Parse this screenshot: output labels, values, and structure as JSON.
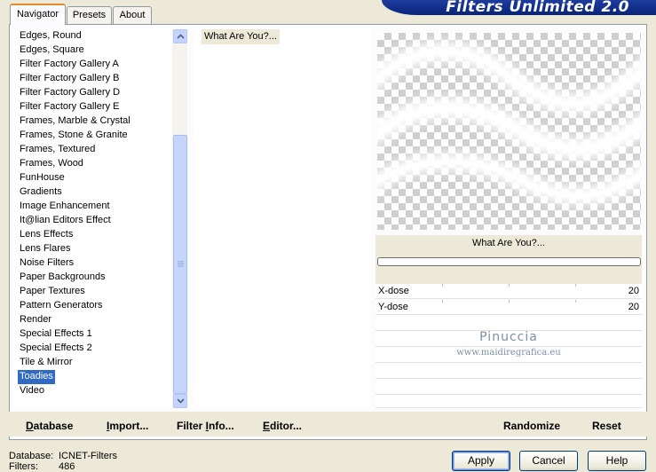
{
  "banner": {
    "title": "Filters Unlimited 2.0"
  },
  "tabs": [
    {
      "label": "Navigator",
      "active": true
    },
    {
      "label": "Presets",
      "active": false
    },
    {
      "label": "About",
      "active": false
    }
  ],
  "categories": [
    "Edges, Round",
    "Edges, Square",
    "Filter Factory Gallery A",
    "Filter Factory Gallery B",
    "Filter Factory Gallery D",
    "Filter Factory Gallery E",
    "Frames, Marble & Crystal",
    "Frames, Stone & Granite",
    "Frames, Textured",
    "Frames, Wood",
    "FunHouse",
    "Gradients",
    "Image Enhancement",
    "It@lian Editors Effect",
    "Lens Effects",
    "Lens Flares",
    "Noise Filters",
    "Paper Backgrounds",
    "Paper Textures",
    "Pattern Generators",
    "Render",
    "Special Effects 1",
    "Special Effects 2",
    "Tile & Mirror",
    "Toadies",
    "Video"
  ],
  "selected_category": "Toadies",
  "scroll_position": 0.65,
  "filters": [
    "What Are You?..."
  ],
  "selected_filter_name": "What Are You?...",
  "progress": 0,
  "params": [
    {
      "label": "X-dose",
      "value": "20"
    },
    {
      "label": "Y-dose",
      "value": "20"
    }
  ],
  "watermark": {
    "name": "Pinuccia",
    "url": "www.maidiregrafica.eu"
  },
  "bottom_actions": {
    "database": {
      "accel": "D",
      "rest": "atabase"
    },
    "import": {
      "accel": "I",
      "rest": "mport..."
    },
    "filter_info": {
      "pre": "Filter ",
      "accel": "I",
      "rest": "nfo..."
    },
    "editor": {
      "accel": "E",
      "rest": "ditor..."
    },
    "randomize": "Randomize",
    "reset": "Reset"
  },
  "status": {
    "database_label": "Database:",
    "database_value": "ICNET-Filters",
    "filters_label": "Filters:",
    "filters_value": "486"
  },
  "buttons": {
    "apply": "Apply",
    "cancel": "Cancel",
    "help": "Help"
  },
  "colors": {
    "selection": "#316ac5",
    "banner": "#0f2f8c",
    "dialog_bg": "#ece9d8"
  }
}
